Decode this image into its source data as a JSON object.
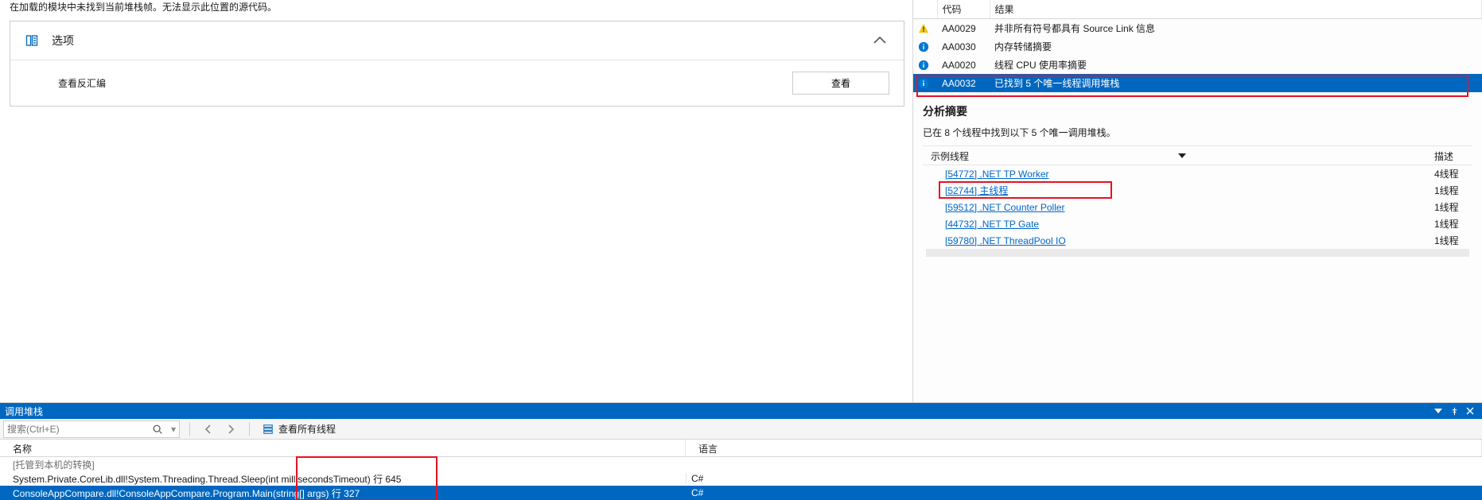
{
  "source_pane": {
    "truncated_message": "在加载的模块中未找到当前堆栈帧。无法显示此位置的源代码。",
    "options_title": "选项",
    "disasm_label": "查看反汇编",
    "view_btn": "查看"
  },
  "diagnostics": {
    "headers": {
      "code": "代码",
      "result": "结果"
    },
    "rows": [
      {
        "icon": "warn",
        "code": "AA0029",
        "result": "并非所有符号都具有 Source Link 信息"
      },
      {
        "icon": "info",
        "code": "AA0030",
        "result": "内存转储摘要"
      },
      {
        "icon": "info",
        "code": "AA0020",
        "result": "线程 CPU 使用率摘要"
      },
      {
        "icon": "info",
        "code": "AA0032",
        "result": "已找到 5 个唯一线程调用堆栈",
        "selected": true
      }
    ],
    "summary": {
      "title": "分析摘要",
      "desc": "已在 8 个线程中找到以下 5 个唯一调用堆栈。",
      "col_thread": "示例线程",
      "col_desc": "描述",
      "threads": [
        {
          "label": "[54772] .NET TP Worker",
          "desc": "4线程"
        },
        {
          "label": "[52744] 主线程",
          "desc": "1线程",
          "boxed": true
        },
        {
          "label": "[59512] .NET Counter Poller",
          "desc": "1线程"
        },
        {
          "label": "[44732] .NET TP Gate",
          "desc": "1线程"
        },
        {
          "label": "[59780] .NET ThreadPool IO",
          "desc": "1线程"
        }
      ]
    }
  },
  "callstack": {
    "window_title": "调用堆栈",
    "search_placeholder": "搜索(Ctrl+E)",
    "view_all_threads": "查看所有线程",
    "columns": {
      "name": "名称",
      "lang": "语言"
    },
    "rows": [
      {
        "name": "[托管到本机的转换]",
        "lang": "",
        "ext": true
      },
      {
        "name": "System.Private.CoreLib.dll!System.Threading.Thread.Sleep(int millisecondsTimeout) 行 645",
        "lang": "C#"
      },
      {
        "name": "ConsoleAppCompare.dll!ConsoleAppCompare.Program.Main(string[] args) 行 327",
        "lang": "C#",
        "selected": true
      }
    ]
  }
}
